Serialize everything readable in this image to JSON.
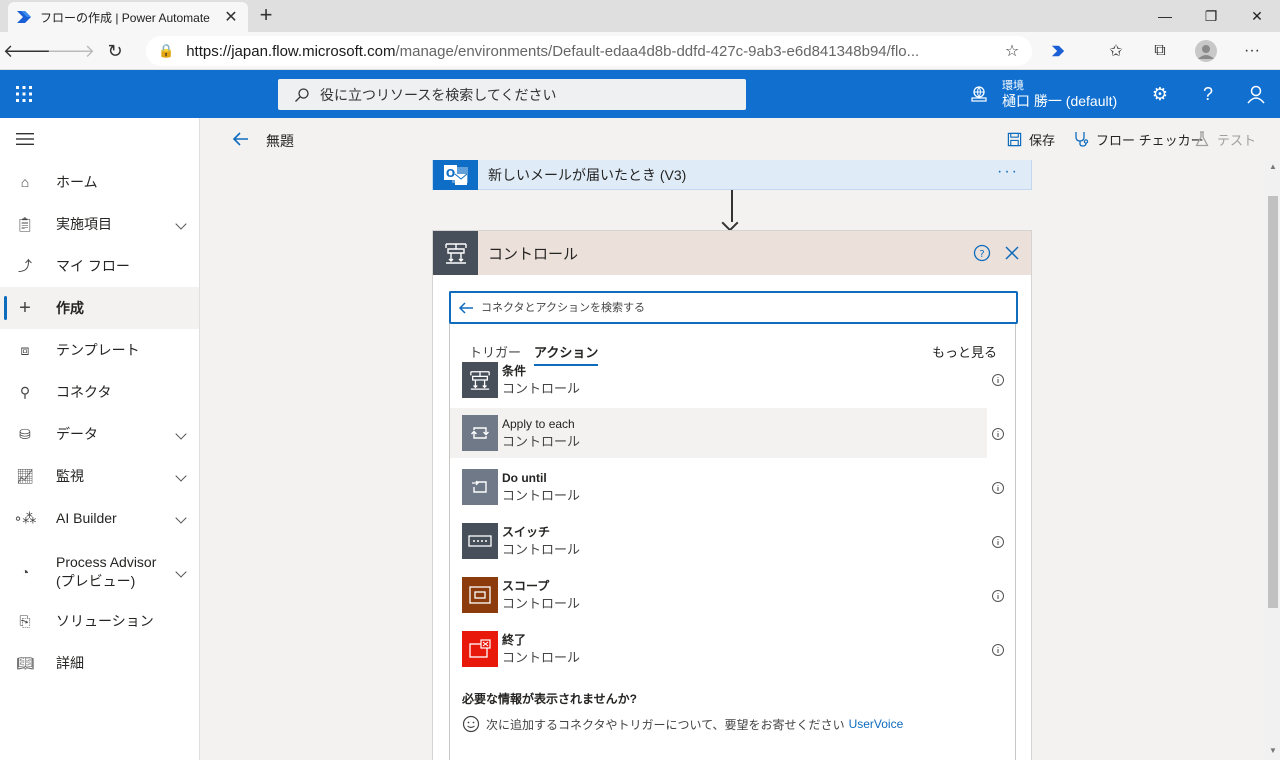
{
  "browser": {
    "tab_title": "フローの作成 | Power Automate",
    "url_host": "https://japan.flow.microsoft.com",
    "url_path": "/manage/environments/Default-edaa4d8b-ddfd-427c-9ab3-e6d841348b94/flo...",
    "new_tab": "+",
    "close": "✕"
  },
  "header": {
    "search_placeholder": "役に立つリソースを検索してください",
    "env_label": "環境",
    "env_name": "樋口 勝一 (default)"
  },
  "nav": {
    "items": [
      {
        "label": "ホーム",
        "icon": "home-icon"
      },
      {
        "label": "実施項目",
        "icon": "clipboard-icon"
      },
      {
        "label": "マイ フロー",
        "icon": "flow-icon"
      },
      {
        "label": "作成",
        "icon": "plus-icon"
      },
      {
        "label": "テンプレート",
        "icon": "template-icon"
      },
      {
        "label": "コネクタ",
        "icon": "connector-icon"
      },
      {
        "label": "データ",
        "icon": "database-icon"
      },
      {
        "label": "監視",
        "icon": "monitor-icon"
      },
      {
        "label": "AI Builder",
        "icon": "ai-builder-icon"
      },
      {
        "label": "Process Advisor\n(プレビュー)",
        "icon": "process-advisor-icon"
      },
      {
        "label": "ソリューション",
        "icon": "solution-icon"
      },
      {
        "label": "詳細",
        "icon": "book-icon"
      }
    ]
  },
  "command_bar": {
    "flow_title": "無題",
    "save": "保存",
    "flow_checker": "フロー チェッカー",
    "test": "テスト"
  },
  "trigger": {
    "label": "新しいメールが届いたとき (V3)",
    "more": "···"
  },
  "control_card": {
    "title": "コントロール",
    "search_placeholder": "コネクタとアクションを検索する",
    "tabs": [
      "トリガー",
      "アクション"
    ],
    "see_more": "もっと見る",
    "actions": [
      {
        "name": "条件",
        "sub": "コントロール",
        "color": "#474f5a"
      },
      {
        "name": "Apply to each",
        "sub": "コントロール",
        "color": "#6f7987"
      },
      {
        "name": "Do until",
        "sub": "コントロール",
        "color": "#6f7987"
      },
      {
        "name": "スイッチ",
        "sub": "コントロール",
        "color": "#474f5a"
      },
      {
        "name": "スコープ",
        "sub": "コントロール",
        "color": "#8c3c0c"
      },
      {
        "name": "終了",
        "sub": "コントロール",
        "color": "#e8190a"
      }
    ],
    "footer_question": "必要な情報が表示されませんか?",
    "footer_text": "次に追加するコネクタやトリガーについて、要望をお寄せください",
    "footer_link": "UserVoice"
  },
  "colors": {
    "header_blue": "#1170cf",
    "accent": "#0f6cbd"
  }
}
